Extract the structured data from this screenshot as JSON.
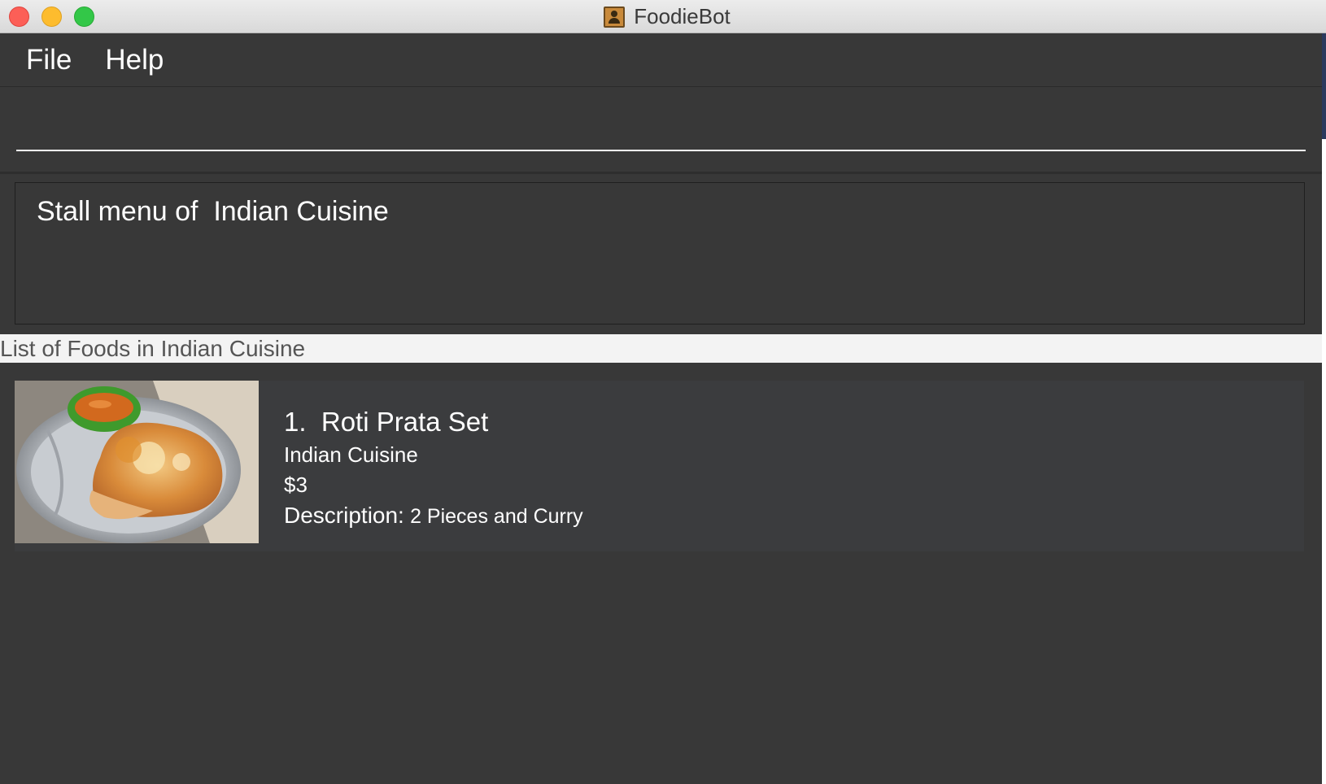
{
  "window": {
    "title": "FoodieBot",
    "app_icon": "contact-book-icon"
  },
  "menu": {
    "items": [
      "File",
      "Help"
    ]
  },
  "command": {
    "value": ""
  },
  "result": {
    "text": "Stall menu of  Indian Cuisine"
  },
  "list": {
    "header": "List of Foods in Indian Cuisine",
    "items": [
      {
        "index": "1.",
        "name": "Roti Prata Set",
        "stall": "Indian Cuisine",
        "price": "$3",
        "description_label": "Description:",
        "description": "2 Pieces and Curry",
        "image": "roti-prata-photo"
      }
    ]
  },
  "colors": {
    "background": "#383838",
    "card": "#3b3c3e",
    "header_bg": "#f3f3f3",
    "close": "#fc5f57",
    "minimize": "#fdbc2e",
    "maximize": "#33c748"
  }
}
